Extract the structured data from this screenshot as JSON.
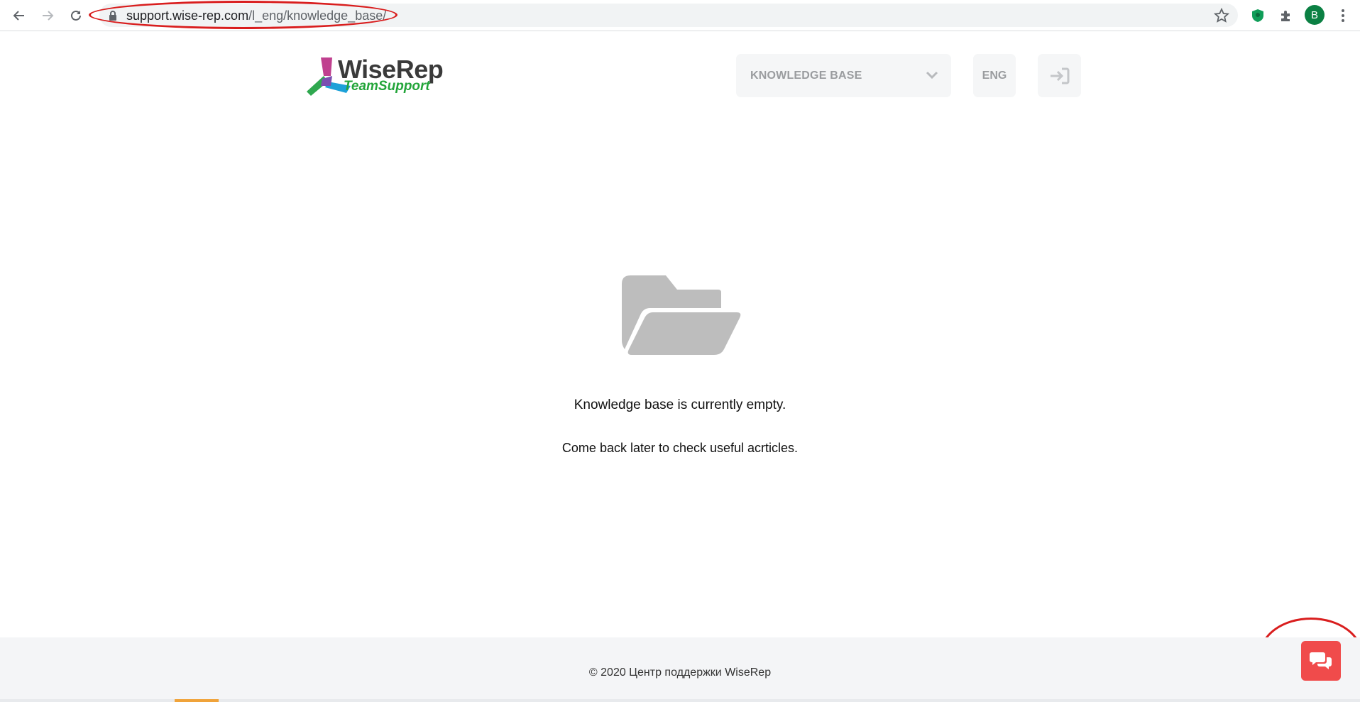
{
  "browser": {
    "url_host": "support.wise-rep.com",
    "url_path": "/l_eng/knowledge_base/",
    "profile_initial": "B"
  },
  "header": {
    "logo_word": "WiseRep",
    "logo_sub": "TeamSupport",
    "section_select": "KNOWLEDGE BASE",
    "language": "ENG"
  },
  "main": {
    "empty_title": "Knowledge base is currently empty.",
    "empty_subtitle": "Come back later to check useful acrticles."
  },
  "footer": {
    "copyright": "© 2020 Центр поддержки WiseRep"
  },
  "colors": {
    "annotation": "#d91e1e",
    "chat_button": "#f04b4b",
    "logo_green": "#23a53a"
  },
  "icons": [
    "back-arrow-icon",
    "forward-arrow-icon",
    "reload-icon",
    "lock-icon",
    "star-icon",
    "shield-extension-icon",
    "puzzle-icon",
    "menu-dots-icon",
    "chevron-down-icon",
    "login-icon",
    "folder-open-icon",
    "chat-icon"
  ]
}
